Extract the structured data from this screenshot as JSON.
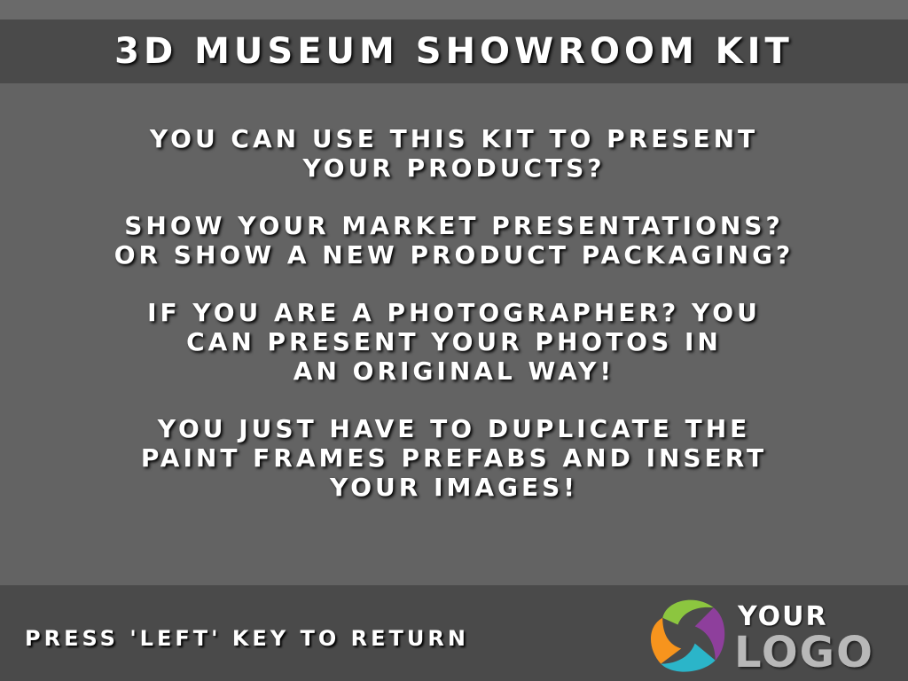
{
  "header": {
    "title": "3D MUSEUM SHOWROOM KIT"
  },
  "content": {
    "paragraphs": [
      {
        "lines": [
          "YOU CAN USE THIS KIT TO PRESENT",
          "YOUR PRODUCTS?"
        ]
      },
      {
        "lines": [
          "SHOW YOUR MARKET PRESENTATIONS?",
          "OR SHOW A NEW PRODUCT PACKAGING?"
        ]
      },
      {
        "lines": [
          "IF YOU ARE A PHOTOGRAPHER? YOU",
          "CAN PRESENT YOUR PHOTOS IN",
          "AN ORIGINAL WAY!"
        ]
      },
      {
        "lines": [
          "YOU JUST HAVE TO DUPLICATE THE",
          "PAINT FRAMES PREFABS AND INSERT",
          "YOUR IMAGES!"
        ]
      }
    ]
  },
  "footer": {
    "hint": "PRESS 'LEFT' KEY TO RETURN",
    "logo": {
      "icon": "logo-swirl-icon",
      "line1": "YOUR",
      "line2": "LOGO",
      "colors": [
        "#8cc63f",
        "#8e3f9c",
        "#2bb5c9",
        "#f7941d"
      ]
    }
  },
  "colors": {
    "background": "#636363",
    "bar": "#4a4a4a",
    "text": "#ffffff",
    "logo_text": "#b8b8b8"
  }
}
